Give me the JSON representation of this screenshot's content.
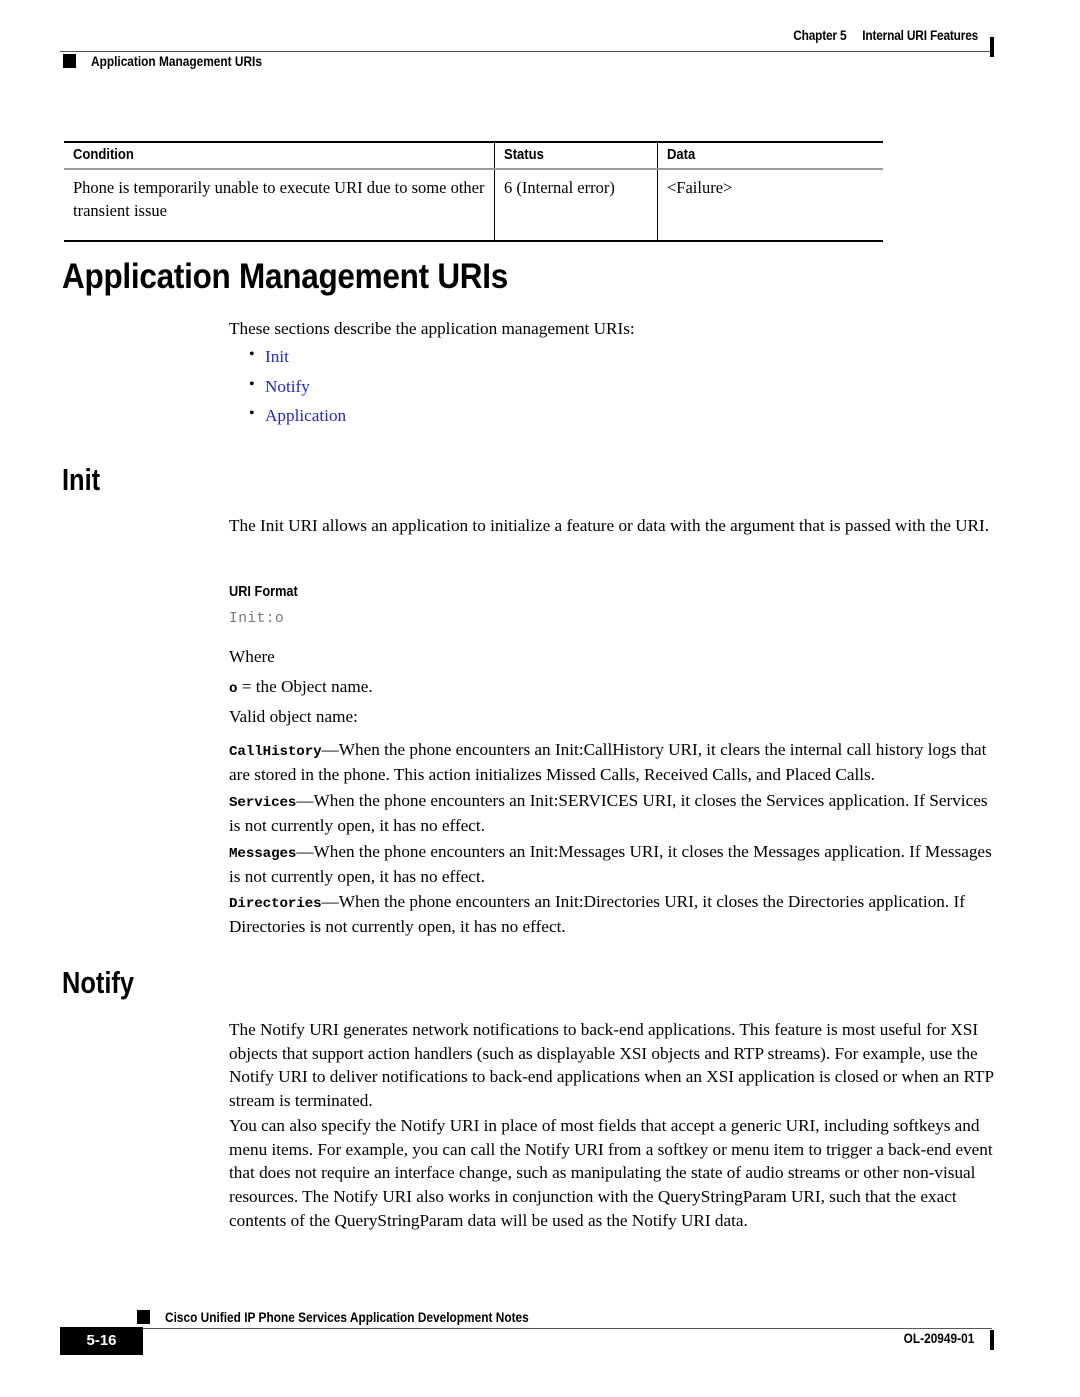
{
  "header": {
    "chapter_label": "Chapter 5",
    "chapter_title": "Internal URI Features",
    "section_title": "Application Management URIs"
  },
  "table": {
    "columns": [
      "Condition",
      "Status",
      "Data"
    ],
    "rows": [
      {
        "condition": "Phone is temporarily unable to execute URI due to some other transient issue",
        "status": "6 (Internal error)",
        "data": "<Failure>"
      }
    ]
  },
  "sections": {
    "app_mgmt": {
      "heading": "Application Management URIs",
      "intro": "These sections describe the application management URIs:",
      "links": [
        "Init",
        "Notify",
        "Application"
      ]
    },
    "init": {
      "heading": "Init",
      "intro": "The Init URI allows an application to initialize a feature or data with the argument that is passed with the URI.",
      "uri_format_label": "URI Format",
      "uri_format_value": "Init:o",
      "where_label": "Where",
      "where_symbol": "o",
      "where_definition": " = the Object name.",
      "valid_object_label": "Valid object name:",
      "objects": [
        {
          "name": "CallHistory",
          "description": "—When the phone encounters an Init:CallHistory URI, it clears the internal call history logs that are stored in the phone. This action initializes Missed Calls, Received Calls, and Placed Calls."
        },
        {
          "name": "Services",
          "description": "—When the phone encounters an Init:SERVICES URI, it closes the Services application. If Services is not currently open, it has no effect."
        },
        {
          "name": "Messages",
          "description": "—When the phone encounters an Init:Messages URI, it closes the Messages application. If Messages is not currently open, it has no effect."
        },
        {
          "name": "Directories",
          "description": "—When the phone encounters an Init:Directories URI, it closes the Directories application. If Directories is not currently open, it has no effect."
        }
      ]
    },
    "notify": {
      "heading": "Notify",
      "paragraph_1": "The Notify URI generates network notifications to back-end applications. This feature is most useful for XSI objects that support action handlers (such as displayable XSI objects and RTP streams). For example, use the Notify URI to deliver notifications to back-end applications when an XSI application is closed or when an RTP stream is terminated.",
      "paragraph_2": "You can also specify the Notify URI in place of most fields that accept a generic URI, including softkeys and menu items. For example, you can call the Notify URI from a softkey or menu item to trigger a back-end event that does not require an interface change, such as manipulating the state of audio streams or other non-visual resources. The Notify URI also works in conjunction with the QueryStringParam URI, such that the exact contents of the QueryStringParam data will be used as the Notify URI data."
    }
  },
  "footer": {
    "doc_title": "Cisco Unified IP Phone Services Application Development Notes",
    "page_number": "5-16",
    "doc_number": "OL-20949-01"
  },
  "colors": {
    "link": "#2727c8",
    "rule": "#555555",
    "mono_grey": "#777777"
  }
}
